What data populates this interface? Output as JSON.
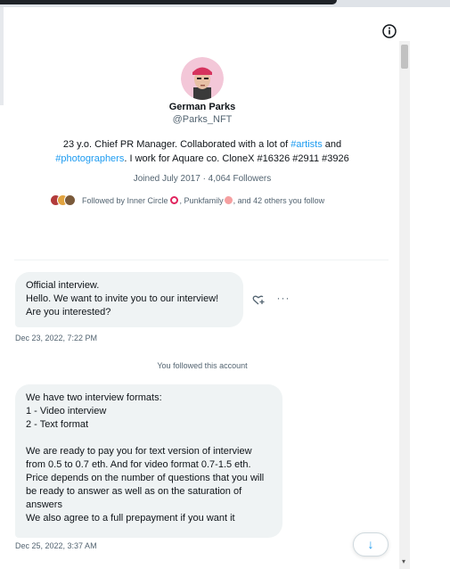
{
  "profile": {
    "name": "German Parks",
    "handle": "@Parks_NFT",
    "bio_pre": "23 y.o. Chief PR Manager. Collaborated with a lot of ",
    "bio_link1": "#artists",
    "bio_mid": " and ",
    "bio_link2": "#photographers",
    "bio_post": ". I work for Aquare co. CloneX #16326 #2911 #3926",
    "meta": "Joined July 2017 · 4,064 Followers",
    "followed_pre": "Followed by Inner Circle",
    "followed_mid": ", Punkfamily",
    "followed_post": ", and 42 others you follow"
  },
  "messages": [
    {
      "text": "Official interview.\nHello. We want to invite you to our interview!\nAre you interested?",
      "time": "Dec 23, 2022, 7:22 PM"
    },
    {
      "text": "We have two interview formats:\n1 - Video interview\n2 - Text format\n\nWe are ready to pay you for text version of interview from 0.5 to 0.7 eth. And for video format 0.7-1.5 eth.\nPrice depends on the number of questions that you will be ready to answer as well as on the saturation of answers\nWe also agree to a full prepayment if you want it",
      "time": "Dec 25, 2022, 3:37 AM"
    }
  ],
  "system_message": "You followed this account",
  "icons": {
    "info": "info-icon",
    "react": "heart-plus-icon",
    "more": "more-icon",
    "scroll_down": "arrow-down-icon"
  },
  "colors": {
    "accent": "#1d9bf0",
    "bubble": "#eff3f4",
    "muted": "#536471",
    "ring": "#e0245e"
  }
}
